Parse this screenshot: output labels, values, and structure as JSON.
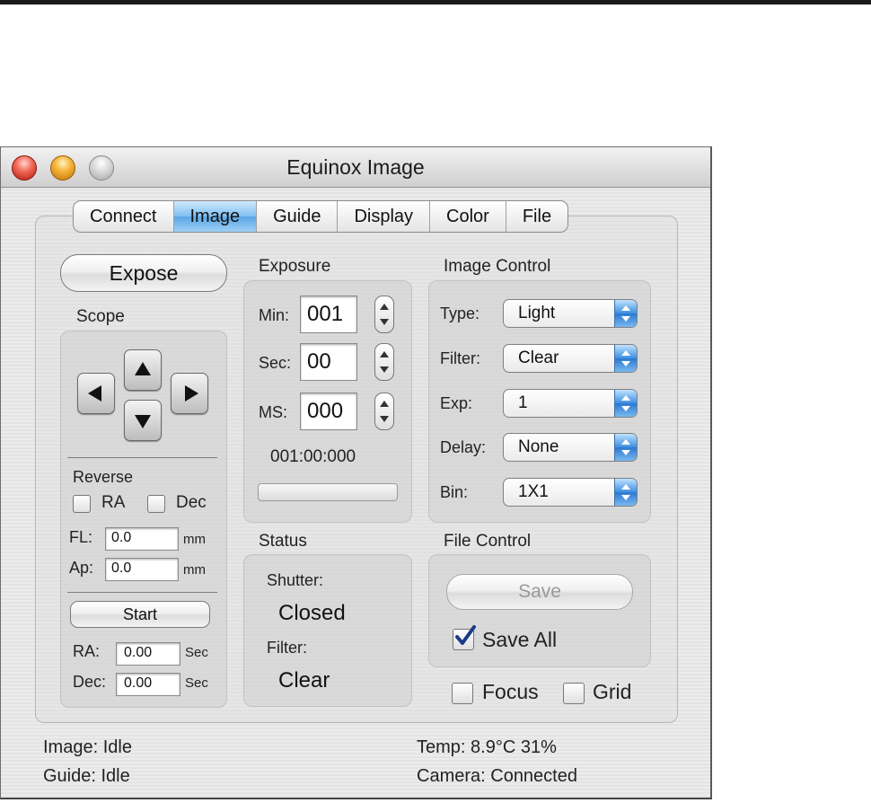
{
  "window": {
    "title": "Equinox Image"
  },
  "tabs": [
    "Connect",
    "Image",
    "Guide",
    "Display",
    "Color",
    "File"
  ],
  "expose_button": "Expose",
  "scope": {
    "label": "Scope",
    "reverse_label": "Reverse",
    "ra_label": "RA",
    "dec_label": "Dec",
    "fl_label": "FL:",
    "fl_value": "0.0",
    "fl_unit": "mm",
    "ap_label": "Ap:",
    "ap_value": "0.0",
    "ap_unit": "mm",
    "start_button": "Start",
    "guide_ra_label": "RA:",
    "guide_ra_value": "0.00",
    "guide_ra_unit": "Sec",
    "guide_dec_label": "Dec:",
    "guide_dec_value": "0.00",
    "guide_dec_unit": "Sec"
  },
  "exposure": {
    "label": "Exposure",
    "min_label": "Min:",
    "min_value": "001",
    "sec_label": "Sec:",
    "sec_value": "00",
    "ms_label": "MS:",
    "ms_value": "000",
    "total": "001:00:000",
    "progress": 0
  },
  "image_control": {
    "label": "Image Control",
    "type_label": "Type:",
    "type_value": "Light",
    "filter_label": "Filter:",
    "filter_value": "Clear",
    "exp_label": "Exp:",
    "exp_value": "1",
    "delay_label": "Delay:",
    "delay_value": "None",
    "bin_label": "Bin:",
    "bin_value": "1X1"
  },
  "status": {
    "label": "Status",
    "shutter_label": "Shutter:",
    "shutter_value": "Closed",
    "filter_label": "Filter:",
    "filter_value": "Clear"
  },
  "file_control": {
    "label": "File Control",
    "save_button": "Save",
    "save_all_label": "Save All",
    "save_all_checked": true
  },
  "focus_label": "Focus",
  "grid_label": "Grid",
  "footer": {
    "image_status": "Image: Idle",
    "guide_status": "Guide: Idle",
    "temp": "Temp: 8.9°C 31%",
    "camera": "Camera: Connected"
  }
}
